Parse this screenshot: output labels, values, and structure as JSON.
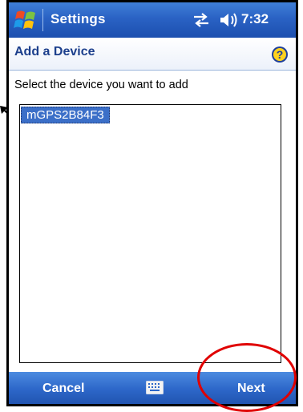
{
  "titlebar": {
    "title": "Settings",
    "time": "7:32"
  },
  "header": {
    "title": "Add a Device"
  },
  "instruction": "Select the device you want to add",
  "devices": [
    {
      "name": "mGPS2B84F3",
      "selected": true
    }
  ],
  "softkeys": {
    "left": "Cancel",
    "right": "Next"
  },
  "icons": {
    "start": "windows-flag-icon",
    "connectivity": "connectivity-arrows-icon",
    "volume": "speaker-icon",
    "help": "help-icon",
    "keyboard": "keyboard-icon"
  },
  "colors": {
    "titlebar": "#2a62c4",
    "header_text": "#1c3f8c",
    "selection": "#3b6fc8",
    "annotation": "#e00000"
  }
}
